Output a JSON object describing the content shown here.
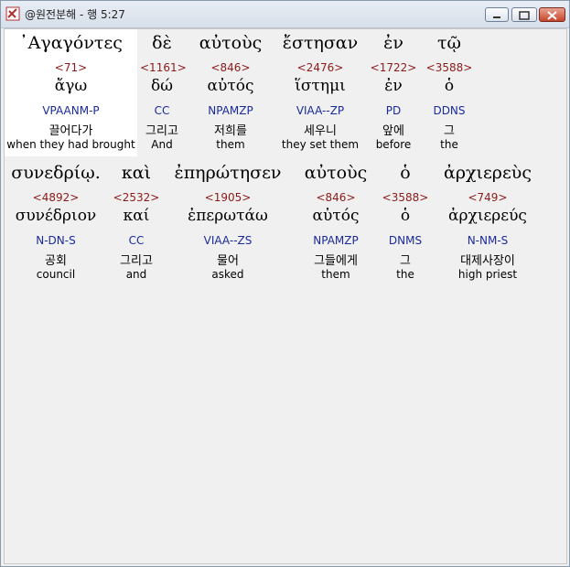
{
  "window": {
    "title": "@원전분해 - 행 5:27"
  },
  "rows": [
    {
      "words": [
        {
          "greek": "᾿Αγαγόντες",
          "strong": "<71>",
          "lemma": "ἄγω",
          "parse": "VPAANM-P",
          "kor": "끌어다가",
          "eng": "when they had brought"
        },
        {
          "greek": "δὲ",
          "strong": "<1161>",
          "lemma": "δώ",
          "parse": "CC",
          "kor": "그리고",
          "eng": "And"
        },
        {
          "greek": "αὐτοὺς",
          "strong": "<846>",
          "lemma": "αὐτός",
          "parse": "NPAMZP",
          "kor": "저희를",
          "eng": "them"
        },
        {
          "greek": "ἔστησαν",
          "strong": "<2476>",
          "lemma": "ἵστημι",
          "parse": "VIAA--ZP",
          "kor": "세우니",
          "eng": "they set them"
        },
        {
          "greek": "ἐν",
          "strong": "<1722>",
          "lemma": "ἐν",
          "parse": "PD",
          "kor": "앞에",
          "eng": "before"
        },
        {
          "greek": "τῷ",
          "strong": "<3588>",
          "lemma": "ὁ",
          "parse": "DDNS",
          "kor": "그",
          "eng": "the"
        }
      ]
    },
    {
      "words": [
        {
          "greek": "συνεδρίῳ.",
          "strong": "<4892>",
          "lemma": "συνέδριον",
          "parse": "N-DN-S",
          "kor": "공회",
          "eng": "council"
        },
        {
          "greek": "καὶ",
          "strong": "<2532>",
          "lemma": "καί",
          "parse": "CC",
          "kor": "그리고",
          "eng": "and"
        },
        {
          "greek": "ἐπηρώτησεν",
          "strong": "<1905>",
          "lemma": "ἐπερωτάω",
          "parse": "VIAA--ZS",
          "kor": "물어",
          "eng": "asked"
        },
        {
          "greek": "αὐτοὺς",
          "strong": "<846>",
          "lemma": "αὐτός",
          "parse": "NPAMZP",
          "kor": "그들에게",
          "eng": "them"
        },
        {
          "greek": "ὁ",
          "strong": "<3588>",
          "lemma": "ὁ",
          "parse": "DNMS",
          "kor": "그",
          "eng": "the"
        },
        {
          "greek": "ἀρχιερεὺς",
          "strong": "<749>",
          "lemma": "ἀρχιερεύς",
          "parse": "N-NM-S",
          "kor": "대제사장이",
          "eng": "high priest"
        }
      ]
    }
  ]
}
